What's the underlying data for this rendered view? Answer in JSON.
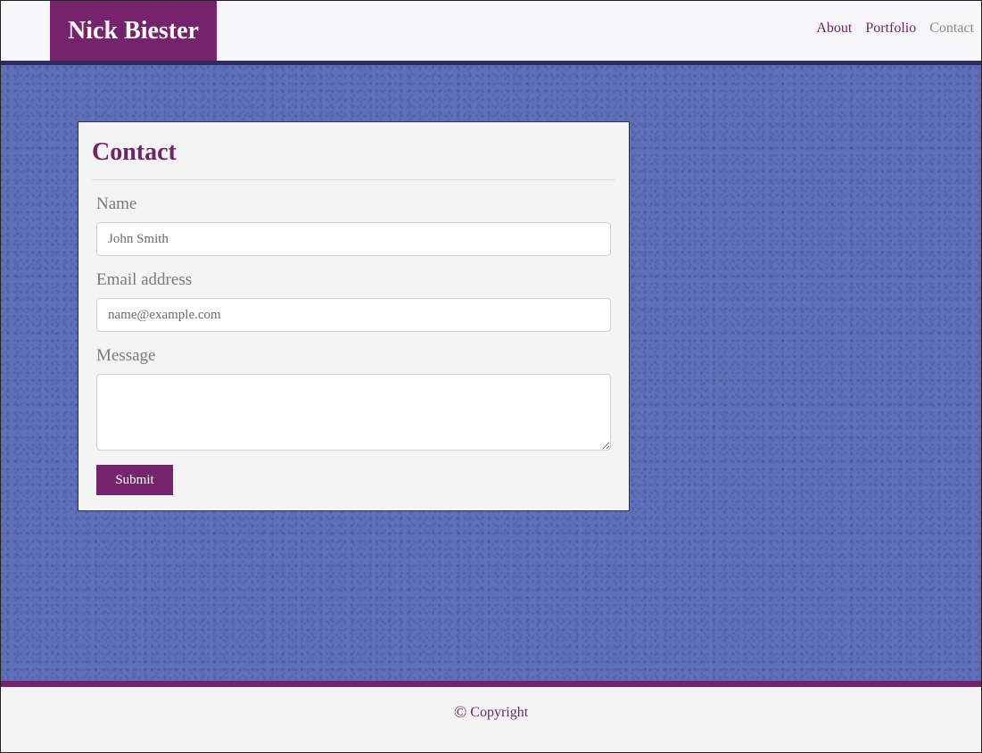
{
  "header": {
    "brand": "Nick Biester",
    "nav": [
      {
        "label": "About"
      },
      {
        "label": "Portfolio"
      },
      {
        "label": "Contact"
      }
    ]
  },
  "contact": {
    "title": "Contact",
    "fields": {
      "name_label": "Name",
      "name_placeholder": "John Smith",
      "email_label": "Email address",
      "email_placeholder": "name@example.com",
      "message_label": "Message",
      "message_value": ""
    },
    "submit_label": "Submit"
  },
  "footer": {
    "icon": "copyright-icon",
    "copyright_symbol": "©",
    "text": "Copyright"
  },
  "colors": {
    "brand": "#76236d",
    "accent_dark": "#2e2a62",
    "background": "#5f70b8"
  }
}
